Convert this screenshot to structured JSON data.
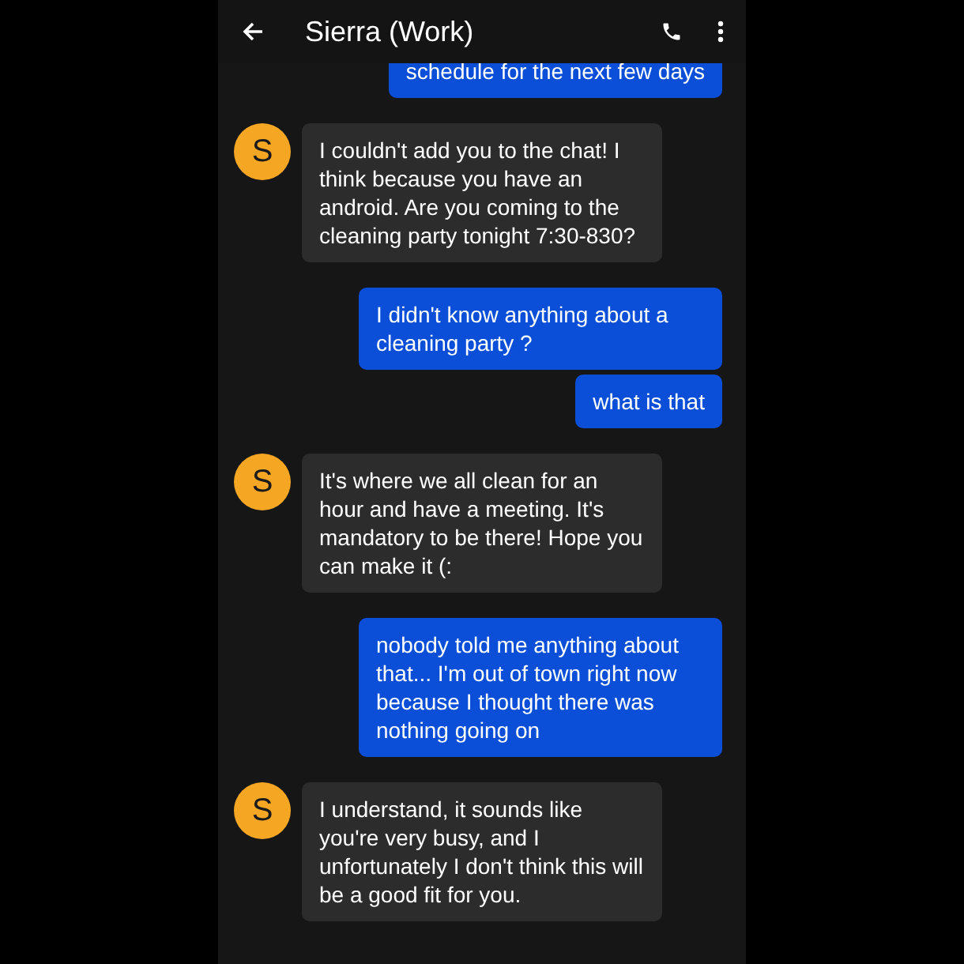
{
  "header": {
    "title": "Sierra (Work)"
  },
  "messages": [
    {
      "kind": "outgoing",
      "text": "schedule for the next few days"
    },
    {
      "kind": "incoming",
      "avatar": "S",
      "text": "I couldn't add you to the chat! I think because you have an android. Are you coming to the cleaning party tonight 7:30-830?"
    },
    {
      "kind": "outgoing",
      "text": "I didn't know anything about a cleaning party ?"
    },
    {
      "kind": "outgoing",
      "text": "what is that"
    },
    {
      "kind": "incoming",
      "avatar": "S",
      "text": "It's where we all clean for an hour and have a meeting. It's mandatory to be there! Hope you can make it (:"
    },
    {
      "kind": "outgoing",
      "text": "nobody told me anything about that... I'm out of town right now because I thought there was nothing going on"
    },
    {
      "kind": "incoming",
      "avatar": "S",
      "text": "I understand, it sounds like you're very busy, and I unfortunately I don't think this will be a good fit for you."
    }
  ]
}
